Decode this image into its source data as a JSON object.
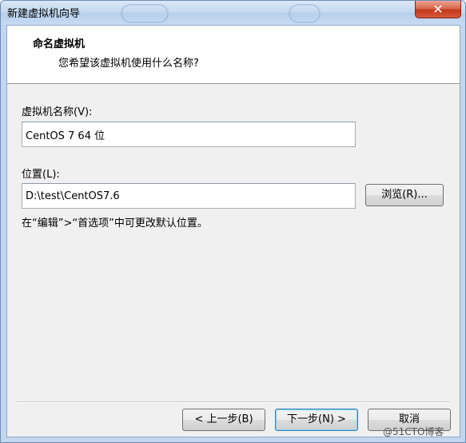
{
  "window": {
    "title": "新建虚拟机向导",
    "close_label": "✕"
  },
  "header": {
    "title": "命名虚拟机",
    "subtitle": "您希望该虚拟机使用什么名称?"
  },
  "form": {
    "name_label": "虚拟机名称(V):",
    "name_value": "CentOS 7 64 位",
    "location_label": "位置(L):",
    "location_value": "D:\\test\\CentOS7.6",
    "browse_label": "浏览(R)...",
    "hint": "在“编辑”>“首选项”中可更改默认位置。"
  },
  "footer": {
    "back_label": "< 上一步(B)",
    "next_label": "下一步(N) >",
    "cancel_label": "取消"
  },
  "watermark": "@51CTO博客",
  "colors": {
    "title_bar": "#c5d9f0",
    "close_button": "#c4391c",
    "default_button_border": "#3c7fb1"
  }
}
